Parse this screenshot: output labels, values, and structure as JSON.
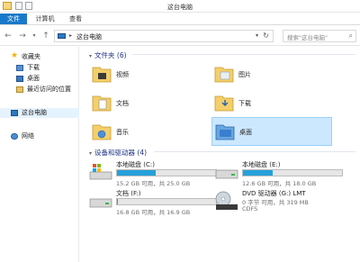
{
  "window": {
    "title": "这台电脑"
  },
  "ribbon": {
    "tabs": [
      {
        "label": "文件"
      },
      {
        "label": "计算机"
      },
      {
        "label": "查看"
      }
    ]
  },
  "address": {
    "crumb": "这台电脑",
    "separator": "▸"
  },
  "search": {
    "placeholder": "搜索\"这台电脑\""
  },
  "nav": {
    "favorites": "收藏夹",
    "downloads": "下载",
    "desktop": "桌面",
    "recent": "最近访问的位置",
    "this_pc": "这台电脑",
    "network": "网络"
  },
  "folders": {
    "header": "文件夹 (6)",
    "items": [
      {
        "label": "视频"
      },
      {
        "label": "图片"
      },
      {
        "label": "文档"
      },
      {
        "label": "下载"
      },
      {
        "label": "音乐"
      },
      {
        "label": "桌面"
      }
    ]
  },
  "drives": {
    "header": "设备和驱动器 (4)",
    "items": [
      {
        "name": "本地磁盘 (C:)",
        "info": "15.2 GB 可用，共 25.0 GB",
        "used_fraction": 0.39
      },
      {
        "name": "本地磁盘 (E:)",
        "info": "12.6 GB 可用，共 18.0 GB",
        "used_fraction": 0.3
      },
      {
        "name": "文档 (F:)",
        "info": "16.8 GB 可用，共 16.9 GB",
        "used_fraction": 0.01
      },
      {
        "name": "DVD 驱动器 (G:) LMT",
        "info": "0 字节 可用，共 319 MB",
        "fs": "CDFS"
      }
    ]
  },
  "colors": {
    "accent": "#1979ca",
    "selection": "#cce8ff",
    "drive_bar": "#26a0da",
    "group_header": "#1e3287"
  }
}
